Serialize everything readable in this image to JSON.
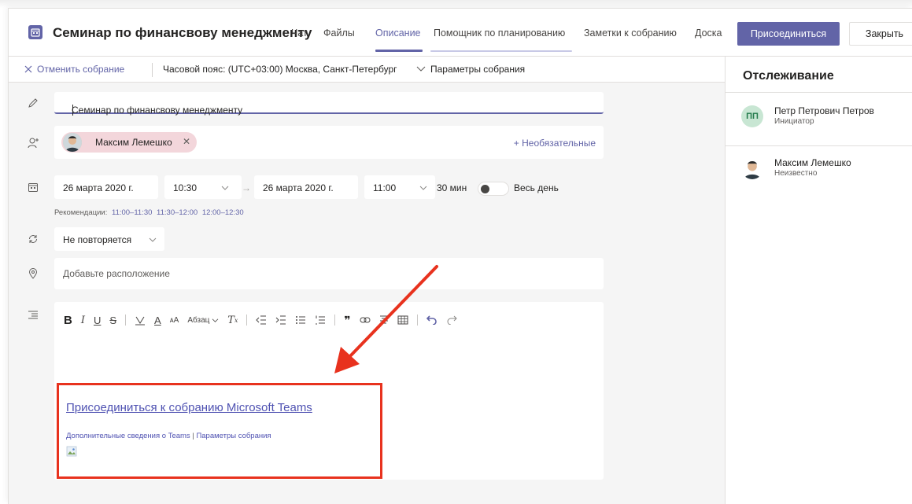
{
  "header": {
    "title": "Семинар по финансвову менеджменту",
    "tabs": [
      {
        "label": "Чат"
      },
      {
        "label": "Файлы"
      },
      {
        "label": "Описание"
      },
      {
        "label": "Помощник по планированию"
      },
      {
        "label": "Заметки к собранию"
      },
      {
        "label": "Доска"
      }
    ],
    "active_tab": "Описание",
    "join_label": "Присоединиться",
    "close_label": "Закрыть"
  },
  "toolbar": {
    "cancel_label": "Отменить собрание",
    "timezone_label": "Часовой пояс: (UTC+03:00) Москва, Санкт-Петербург",
    "params_label": "Параметры собрания"
  },
  "form": {
    "title_value": "Семинар по финансвову менеджменту",
    "attendee": {
      "name": "Максим Лемешко"
    },
    "optional_label": "+ Необязательные",
    "start_date": "26 марта 2020 г.",
    "start_time": "10:30",
    "end_date": "26 марта 2020 г.",
    "end_time": "11:00",
    "duration": "30 мин",
    "all_day_label": "Весь день",
    "recommendations_label": "Рекомендации:",
    "recommendation_slots": [
      "11:00–11:30",
      "11:30–12:00",
      "12:00–12:30"
    ],
    "repeat_value": "Не повторяется",
    "location_placeholder": "Добавьте расположение",
    "editor": {
      "paragraph_label": "Абзац",
      "join_link": "Присоединиться к собранию Microsoft Teams",
      "more_info_link": "Дополнительные сведения о Teams",
      "separator": "|",
      "meeting_params_link": "Параметры собрания"
    }
  },
  "tracking": {
    "title": "Отслеживание",
    "people": [
      {
        "initials": "ПП",
        "name": "Петр Петрович Петров",
        "role": "Инициатор"
      },
      {
        "name": "Максим Лемешко",
        "role": "Неизвестно"
      }
    ]
  },
  "colors": {
    "accent": "#6264a7",
    "annotation_red": "#e8321e",
    "form_background": "#f5f5f5"
  }
}
